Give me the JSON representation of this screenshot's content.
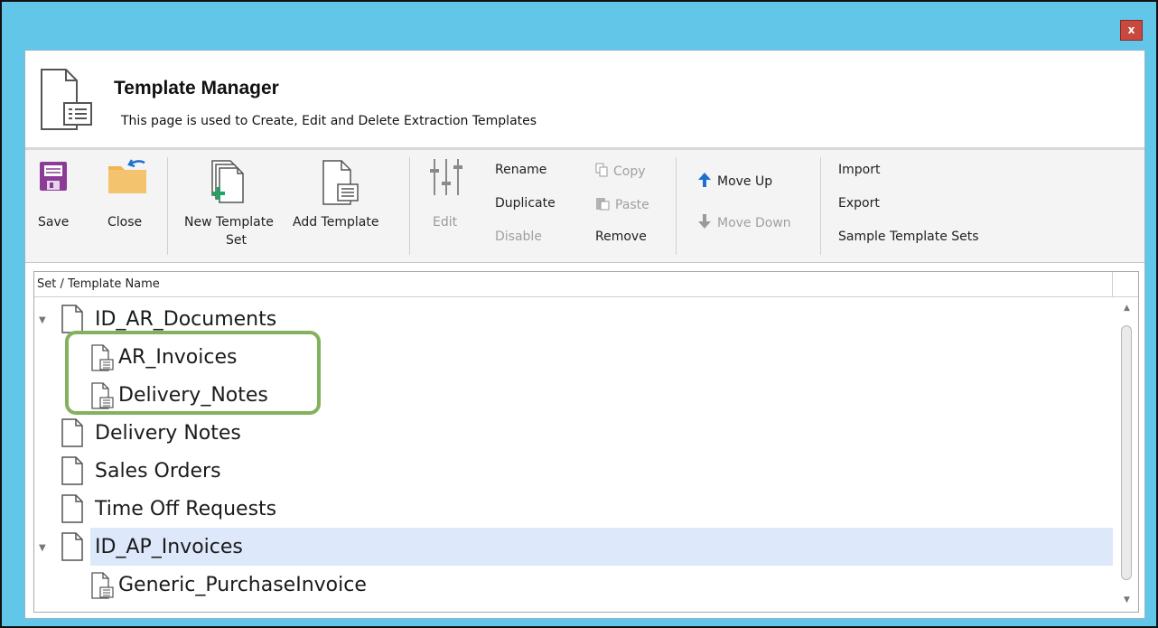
{
  "window": {
    "close_label": "x"
  },
  "header": {
    "title": "Template Manager",
    "subtitle": "This page is used to Create, Edit and Delete Extraction Templates"
  },
  "ribbon": {
    "save": "Save",
    "close": "Close",
    "new_template_set_line1": "New Template",
    "new_template_set_line2": "Set",
    "add_template": "Add Template",
    "edit": "Edit",
    "rename": "Rename",
    "duplicate": "Duplicate",
    "disable": "Disable",
    "copy": "Copy",
    "paste": "Paste",
    "remove": "Remove",
    "move_up": "Move Up",
    "move_down": "Move Down",
    "import": "Import",
    "export": "Export",
    "sample_template_sets": "Sample Template Sets"
  },
  "tree": {
    "column_header": "Set / Template Name",
    "rows": [
      {
        "label": "ID_AR_Documents",
        "type": "set",
        "expanded": true,
        "level": 0
      },
      {
        "label": "AR_Invoices",
        "type": "template",
        "level": 1
      },
      {
        "label": "Delivery_Notes",
        "type": "template",
        "level": 1
      },
      {
        "label": "Delivery Notes",
        "type": "set",
        "level": 0
      },
      {
        "label": "Sales Orders",
        "type": "set",
        "level": 0
      },
      {
        "label": "Time Off Requests",
        "type": "set",
        "level": 0
      },
      {
        "label": "ID_AP_Invoices",
        "type": "set",
        "expanded": true,
        "level": 0,
        "selected": true
      },
      {
        "label": "Generic_PurchaseInvoice",
        "type": "template",
        "level": 1
      }
    ]
  },
  "colors": {
    "title_bar": "#62c6e8",
    "close_button": "#c8493f",
    "selection": "#dde8fb",
    "highlight_border": "#84b15d",
    "save_icon": "#8b3d96",
    "close_folder": "#f0b454",
    "add_icon": "#21a366",
    "arrow_blue": "#1f6fd1"
  }
}
